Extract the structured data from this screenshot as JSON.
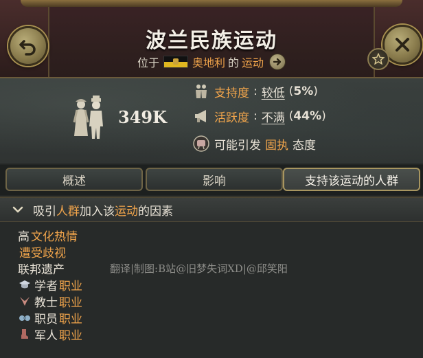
{
  "header": {
    "title": "波兰民族运动",
    "location_prefix": "位于",
    "country": "奥地利",
    "connector": "的",
    "movement_word": "运动"
  },
  "info": {
    "population": "349K",
    "support": {
      "label": "支持度",
      "colon": ":",
      "level": "较低",
      "percent_open": "(",
      "percent": "5%",
      "percent_close": ")"
    },
    "activism": {
      "label": "活跃度",
      "colon": ":",
      "level": "不满",
      "percent_open": "(",
      "percent": "44%",
      "percent_close": ")"
    },
    "attitude": {
      "prefix": "可能引发",
      "highlight": "固执",
      "suffix": "态度"
    }
  },
  "tabs": [
    {
      "label": "概述",
      "active": false
    },
    {
      "label": "影响",
      "active": false
    },
    {
      "label": "支持该运动的人群",
      "active": true
    }
  ],
  "section": {
    "prefix": "吸引",
    "h1": "人群",
    "middle": "加入该",
    "h2": "运动",
    "suffix": "的因素"
  },
  "factors": [
    {
      "plain": "高",
      "highlight": "文化热情",
      "icon": ""
    },
    {
      "plain": "",
      "highlight": "遭受歧视",
      "icon": ""
    },
    {
      "plain": "联邦遗产",
      "highlight": "",
      "icon": ""
    },
    {
      "plain": "学者",
      "highlight": "职业",
      "icon": "academics-icon"
    },
    {
      "plain": "教士",
      "highlight": "职业",
      "icon": "clergy-icon"
    },
    {
      "plain": "职员",
      "highlight": "职业",
      "icon": "clerks-icon"
    },
    {
      "plain": "军人",
      "highlight": "职业",
      "icon": "soldiers-icon"
    }
  ],
  "watermark": "翻译|制图:B站@旧梦失词XD|@邱笑阳",
  "colors": {
    "highlight": "#f0a44b",
    "panel_bg": "#272a29",
    "header_bg": "#3b2326",
    "gold_border": "#a89660"
  }
}
